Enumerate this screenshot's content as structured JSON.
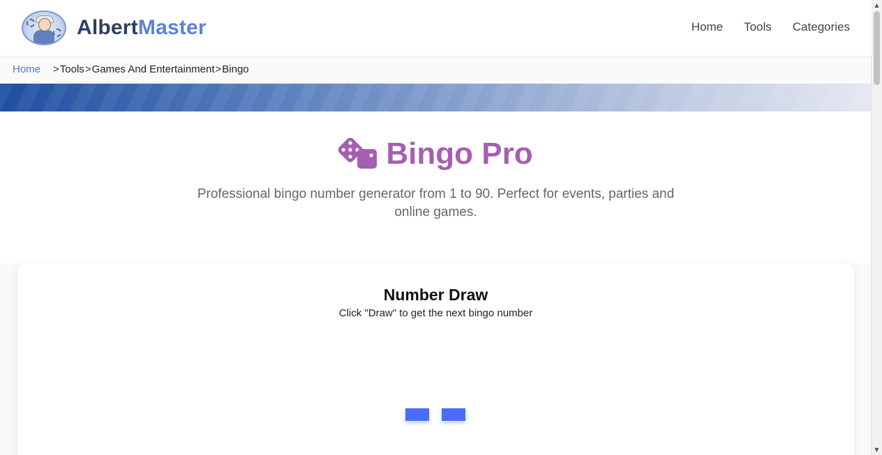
{
  "header": {
    "logo_part1": "Albert",
    "logo_part2": "Master",
    "nav": {
      "home": "Home",
      "tools": "Tools",
      "categories": "Categories"
    }
  },
  "breadcrumb": {
    "home": "Home",
    "sep1": ">",
    "tools": "Tools",
    "sep2": ">",
    "category": "Games And Entertainment",
    "sep3": ">",
    "current": "Bingo"
  },
  "hero": {
    "title": "Bingo Pro",
    "subtitle": "Professional bingo number generator from 1 to 90. Perfect for events, parties and online games."
  },
  "card": {
    "title": "Number Draw",
    "subtitle": "Click \"Draw\" to get the next bingo number"
  },
  "icons": {
    "logo": "albertmaster-avatar-logo",
    "title_icon": "dice-icon",
    "scroll_up": "scroll-up-arrow-icon",
    "scroll_down": "scroll-down-arrow-icon"
  },
  "colors": {
    "brand_dark": "#2d3e63",
    "brand_blue": "#5b82d6",
    "title_purple": "#a55fb0",
    "loader_blue": "#4a6cf7",
    "breadcrumb_link": "#4a7bd0"
  }
}
